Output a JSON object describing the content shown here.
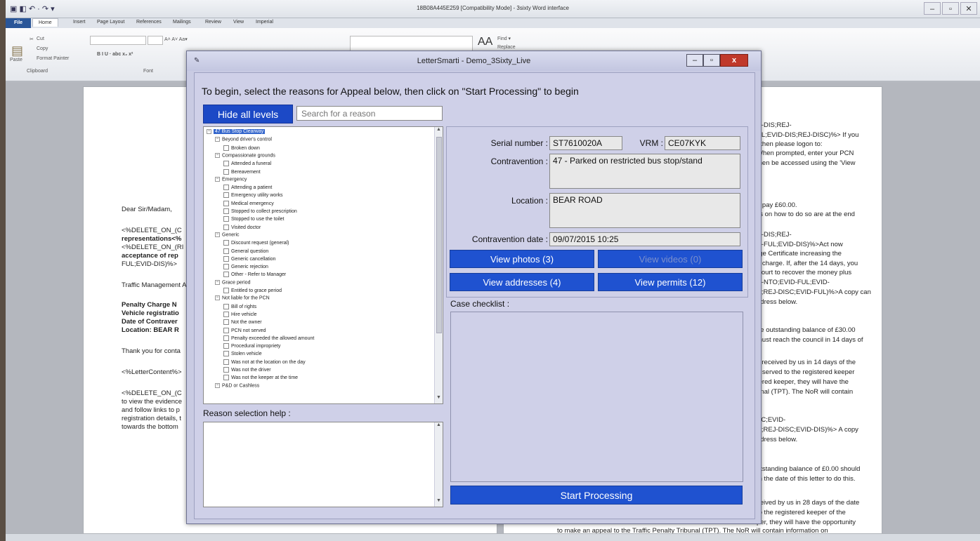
{
  "word": {
    "title": "18B08A445E259 [Compatibility Mode] - 3sixty Word interface",
    "window_controls": [
      "–",
      "▫",
      "✕"
    ],
    "tabs": [
      "File",
      "Home",
      "Insert",
      "Page Layout",
      "References",
      "Mailings",
      "Review",
      "View",
      "Imperial"
    ],
    "ribbon": {
      "cut": "Cut",
      "copy": "Copy",
      "paste": "Paste",
      "format_painter": "Format Painter",
      "clipboard": "Clipboard",
      "font": "Font",
      "find": "Find ▾",
      "replace": "Replace"
    },
    "left_page": [
      {
        "text": "Dear Sir/Madam,",
        "bold": false
      },
      {
        "text": "<%DELETE_ON_(C",
        "bold": false
      },
      {
        "text": "representations<%",
        "bold": true
      },
      {
        "text": "<%DELETE_ON_(RI",
        "bold": false
      },
      {
        "text": "acceptance of rep",
        "bold": true
      },
      {
        "text": "FUL;EVID-DIS)%>",
        "bold": false
      },
      {
        "text": "Traffic Management A",
        "bold": false
      },
      {
        "text": "Penalty Charge N",
        "bold": true
      },
      {
        "text": "Vehicle registratio",
        "bold": true
      },
      {
        "text": "Date of Contraver",
        "bold": true
      },
      {
        "text": "Location: BEAR R",
        "bold": true
      },
      {
        "text": "Thank you for conta",
        "bold": false
      },
      {
        "text": "<%LetterContent%>",
        "bold": false
      },
      {
        "text": "<%DELETE_ON_(C",
        "bold": false
      },
      {
        "text": "to view the evidence",
        "bold": false
      },
      {
        "text": "and follow links to p",
        "bold": false
      },
      {
        "text": "registration details, t",
        "bold": false
      },
      {
        "text": "towards the bottom",
        "bold": false
      }
    ],
    "right_page": [
      "D-DIS;REJ-",
      "UL;EVID-DIS;REJ-DISC)%> If you",
      ", then please logon to:",
      "When prompted, enter your PCN",
      "then be accessed using the 'View",
      "o pay £60.00.",
      "ils on how to do so are at the end",
      "D-DIS;REJ-",
      "D-FUL;EVID-DIS)%>Act now",
      "rge Certificate increasing the",
      "d charge. If, after the 14 days, you",
      "Court to recover the money plus",
      "D-NTO;EVID-FUL;EVID-",
      "C;REJ-DISC;EVID-FUL)%>A copy can",
      "ddress below.",
      "he outstanding balance of £30.00",
      "must reach the council in 14 days of",
      "s received by us in 14 days of the",
      "e served to the registered keeper",
      "tered keeper, they will have the",
      "unal (TPT). The NoR will contain",
      "SC;EVID-",
      "C;REJ-DISC;EVID-DIS)%> A copy",
      "ddress below.",
      "utstanding balance of £0.00 should",
      "m the date of this letter to do this.",
      "ceived by us in 28 days of the date",
      "to the registered keeper of the",
      "per, they will have the opportunity",
      "to make an appeal to the Traffic Penalty Tribunal (TPT). The NoR will contain information on"
    ]
  },
  "dialog": {
    "title": "LetterSmarti - Demo_3Sixty_Live",
    "window_controls": [
      "–",
      "▫",
      "x"
    ],
    "instruction": "To begin, select the reasons for Appeal below, then click on \"Start Processing\" to begin",
    "hide_levels_label": "Hide all levels",
    "search_placeholder": "Search for a reason",
    "tree": [
      {
        "label": "47 Bus Stop Clearway",
        "level": 0,
        "type": "expander",
        "selected": true
      },
      {
        "label": "Beyond driver's control",
        "level": 1,
        "type": "expander"
      },
      {
        "label": "Broken down",
        "level": 2,
        "type": "check"
      },
      {
        "label": "Compassionate grounds",
        "level": 1,
        "type": "expander"
      },
      {
        "label": "Attended a funeral",
        "level": 2,
        "type": "check"
      },
      {
        "label": "Bereavement",
        "level": 2,
        "type": "check"
      },
      {
        "label": "Emergency",
        "level": 1,
        "type": "expander"
      },
      {
        "label": "Attending a patient",
        "level": 2,
        "type": "check"
      },
      {
        "label": "Emergency utility works",
        "level": 2,
        "type": "check"
      },
      {
        "label": "Medical emergency",
        "level": 2,
        "type": "check"
      },
      {
        "label": "Stopped to collect prescription",
        "level": 2,
        "type": "check"
      },
      {
        "label": "Stopped to use the toilet",
        "level": 2,
        "type": "check"
      },
      {
        "label": "Visited doctor",
        "level": 2,
        "type": "check"
      },
      {
        "label": "Generic",
        "level": 1,
        "type": "expander"
      },
      {
        "label": "Discount request (general)",
        "level": 2,
        "type": "check"
      },
      {
        "label": "General question",
        "level": 2,
        "type": "check"
      },
      {
        "label": "Generic cancellation",
        "level": 2,
        "type": "check"
      },
      {
        "label": "Generic rejection",
        "level": 2,
        "type": "check"
      },
      {
        "label": "Other - Refer to Manager",
        "level": 2,
        "type": "check"
      },
      {
        "label": "Grace period",
        "level": 1,
        "type": "expander"
      },
      {
        "label": "Entitled to grace period",
        "level": 2,
        "type": "check"
      },
      {
        "label": "Not liable for the PCN",
        "level": 1,
        "type": "expander"
      },
      {
        "label": "Bill of rights",
        "level": 2,
        "type": "check"
      },
      {
        "label": "Hire vehicle",
        "level": 2,
        "type": "check"
      },
      {
        "label": "Not the owner",
        "level": 2,
        "type": "check"
      },
      {
        "label": "PCN not served",
        "level": 2,
        "type": "check"
      },
      {
        "label": "Penalty exceeded the allowed amount",
        "level": 2,
        "type": "check"
      },
      {
        "label": "Procedural impropriety",
        "level": 2,
        "type": "check"
      },
      {
        "label": "Stolen vehicle",
        "level": 2,
        "type": "check"
      },
      {
        "label": "Was not at the location on the day",
        "level": 2,
        "type": "check"
      },
      {
        "label": "Was not the driver",
        "level": 2,
        "type": "check"
      },
      {
        "label": "Was not the keeper at the time",
        "level": 2,
        "type": "check"
      },
      {
        "label": "P&D or Cashless",
        "level": 1,
        "type": "expander"
      }
    ],
    "reason_help_label": "Reason selection help :",
    "reason_help_text": "",
    "fields": {
      "serial_label": "Serial number :",
      "serial_value": "ST7610020A",
      "vrm_label": "VRM :",
      "vrm_value": "CE07KYK",
      "contravention_label": "Contravention :",
      "contravention_value": "47 - Parked on restricted bus stop/stand",
      "location_label": "Location :",
      "location_value": "BEAR ROAD",
      "date_label": "Contravention date :",
      "date_value": "09/07/2015 10:25"
    },
    "buttons": {
      "photos": "View photos (3)",
      "videos": "View videos (0)",
      "addresses": "View addresses (4)",
      "permits": "View permits (12)",
      "start": "Start Processing"
    },
    "checklist_label": "Case checklist :"
  }
}
